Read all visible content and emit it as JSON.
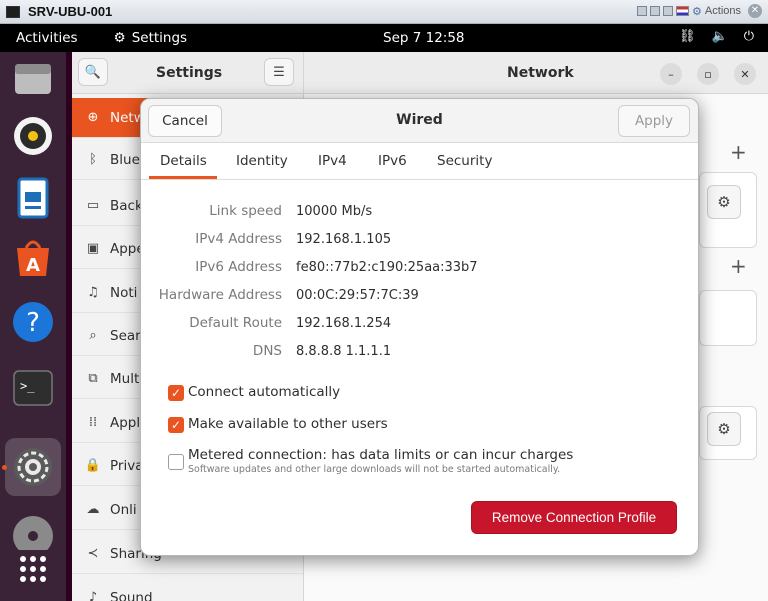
{
  "vm": {
    "title": "SRV-UBU-001",
    "actions_label": "Actions"
  },
  "topbar": {
    "activities": "Activities",
    "app_name": "Settings",
    "clock": "Sep 7  12:58"
  },
  "settings": {
    "sidebar_title": "Settings",
    "panel_title": "Network",
    "sidebar_items": [
      {
        "label": "Netw",
        "icon": "network-icon"
      },
      {
        "label": "Blue",
        "icon": "bluetooth-icon"
      },
      {
        "label": "Back",
        "icon": "background-icon"
      },
      {
        "label": "Appe",
        "icon": "appearance-icon"
      },
      {
        "label": "Noti",
        "icon": "bell-icon"
      },
      {
        "label": "Sear",
        "icon": "search-icon"
      },
      {
        "label": "Mult",
        "icon": "multitasking-icon"
      },
      {
        "label": "Appl",
        "icon": "apps-grid-icon"
      },
      {
        "label": "Priva",
        "icon": "lock-icon"
      },
      {
        "label": "Onli",
        "icon": "cloud-icon"
      },
      {
        "label": "Sharing",
        "icon": "share-icon"
      },
      {
        "label": "Sound",
        "icon": "music-note-icon"
      }
    ]
  },
  "dialog": {
    "title": "Wired",
    "cancel_label": "Cancel",
    "apply_label": "Apply",
    "tabs": [
      "Details",
      "Identity",
      "IPv4",
      "IPv6",
      "Security"
    ],
    "active_tab": "Details",
    "properties": [
      {
        "label": "Link speed",
        "value": "10000 Mb/s"
      },
      {
        "label": "IPv4 Address",
        "value": "192.168.1.105"
      },
      {
        "label": "IPv6 Address",
        "value": "fe80::77b2:c190:25aa:33b7"
      },
      {
        "label": "Hardware Address",
        "value": "00:0C:29:57:7C:39"
      },
      {
        "label": "Default Route",
        "value": "192.168.1.254"
      },
      {
        "label": "DNS",
        "value": "8.8.8.8 1.1.1.1"
      }
    ],
    "options": {
      "connect_automatically": {
        "label": "Connect automatically",
        "checked": true
      },
      "available_to_others": {
        "label": "Make available to other users",
        "checked": true
      },
      "metered": {
        "label": "Metered connection: has data limits or can incur charges",
        "sublabel": "Software updates and other large downloads will not be started automatically.",
        "checked": false
      }
    },
    "remove_label": "Remove Connection Profile"
  },
  "colors": {
    "accent": "#e95420",
    "destructive": "#c7162b",
    "dock": "#3a2336",
    "topbar": "#000000"
  }
}
